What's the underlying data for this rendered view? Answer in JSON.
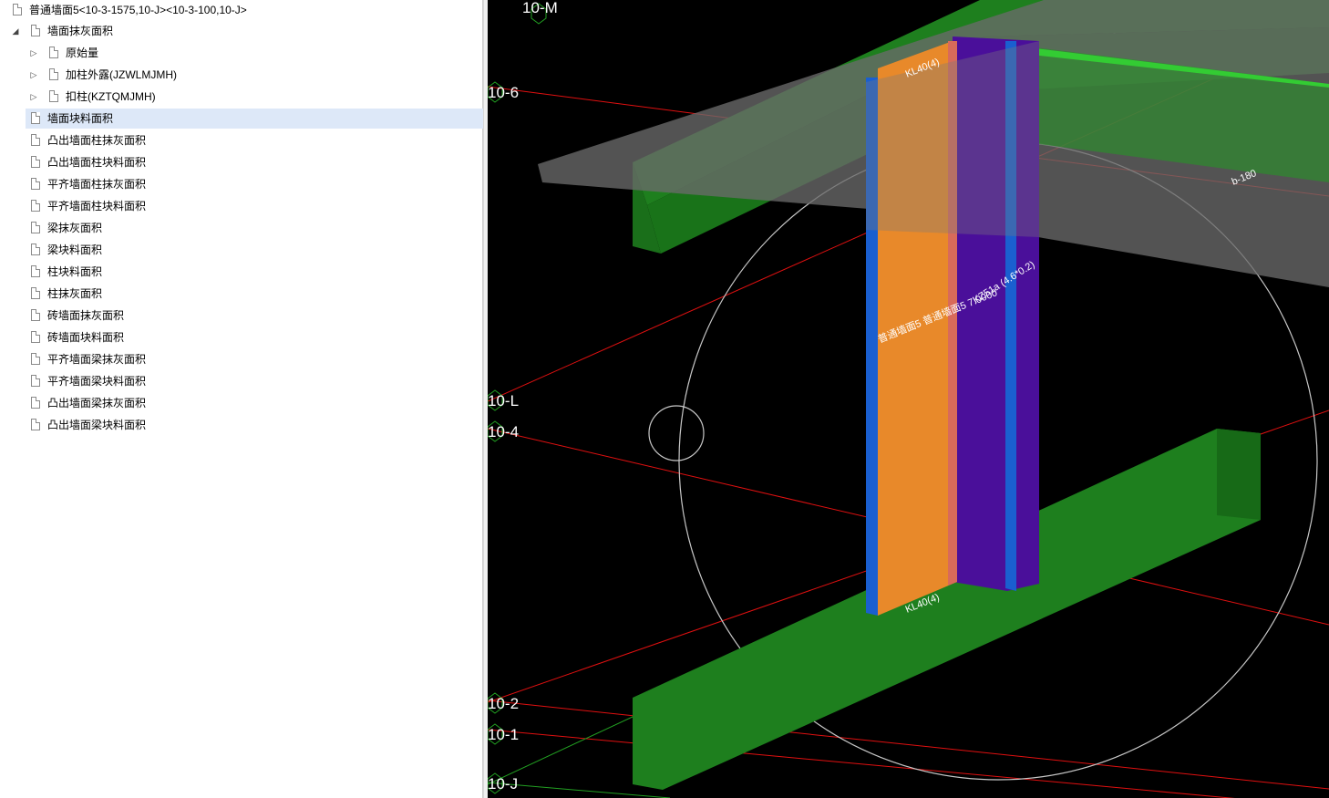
{
  "tree": {
    "root_label": "普通墙面5<10-3-1575,10-J><10-3-100,10-J>",
    "items": [
      {
        "label": "墙面抹灰面积"
      },
      {
        "label": "原始量"
      },
      {
        "label": "加柱外露(JZWLMJMH)"
      },
      {
        "label": "扣柱(KZTQMJMH)"
      },
      {
        "label": "墙面块料面积"
      },
      {
        "label": "凸出墙面柱抹灰面积"
      },
      {
        "label": "凸出墙面柱块料面积"
      },
      {
        "label": "平齐墙面柱抹灰面积"
      },
      {
        "label": "平齐墙面柱块料面积"
      },
      {
        "label": "梁抹灰面积"
      },
      {
        "label": "梁块料面积"
      },
      {
        "label": "柱块料面积"
      },
      {
        "label": "柱抹灰面积"
      },
      {
        "label": "砖墙面抹灰面积"
      },
      {
        "label": "砖墙面块料面积"
      },
      {
        "label": "平齐墙面梁抹灰面积"
      },
      {
        "label": "平齐墙面梁块料面积"
      },
      {
        "label": "凸出墙面梁抹灰面积"
      },
      {
        "label": "凸出墙面梁块料面积"
      }
    ]
  },
  "viewport": {
    "axis_labels": {
      "m": "10-M",
      "six": "10-6",
      "l": "10-L",
      "four": "10-4",
      "two": "10-2",
      "one": "10-1",
      "j": "10-J"
    },
    "beam_top_label": "KL40(4)",
    "beam_bottom_label": "KL40(4)",
    "slab_label": "b-180",
    "wall_label": "普通墙面5 普通墙面5 7.0000",
    "column_label": "KZ51a (4.6*0.2)",
    "colors": {
      "background": "#000000",
      "beam_green": "#1e7f1e",
      "slab_gray": "#5a5a5a",
      "wall_orange": "#e8892a",
      "column_purple": "#4a0f9a",
      "column_blue": "#1a5fd0",
      "axis_red": "#e01010",
      "orbit_gray": "#bfbfbf",
      "tree_selected": "#dde8f8"
    }
  }
}
